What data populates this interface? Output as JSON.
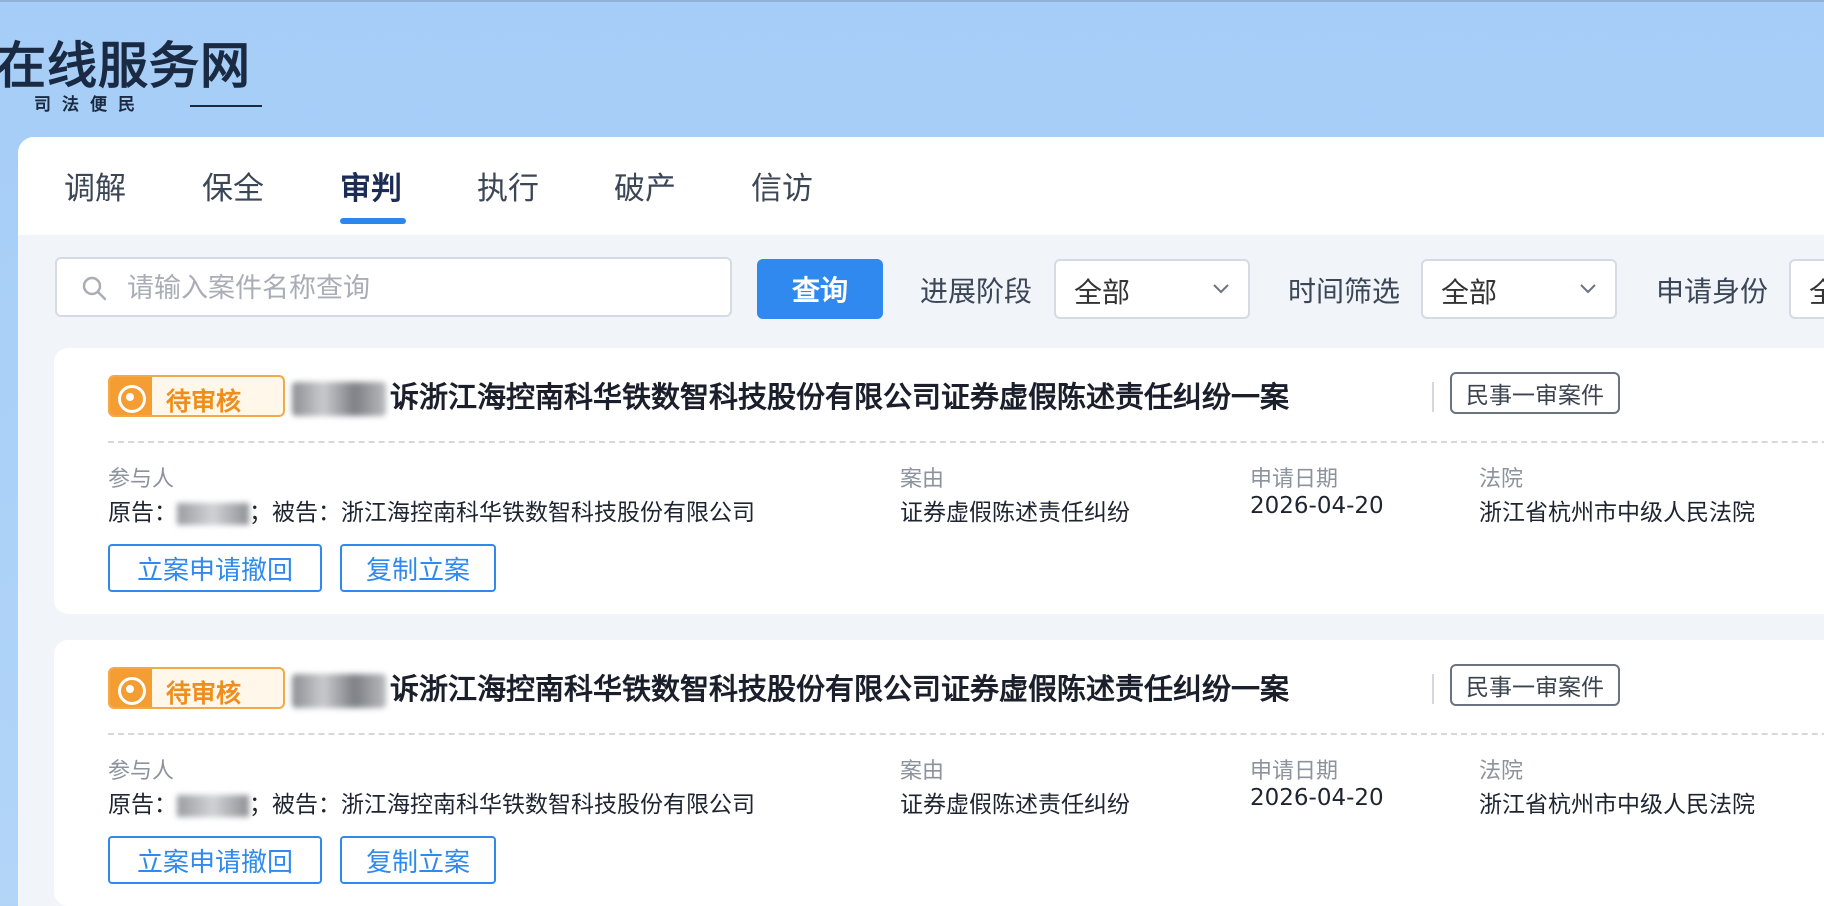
{
  "header": {
    "logo_title": "在线服务网",
    "logo_subtitle": "司法便民"
  },
  "tabs": [
    {
      "label": "调解",
      "active": false
    },
    {
      "label": "保全",
      "active": false
    },
    {
      "label": "审判",
      "active": true
    },
    {
      "label": "执行",
      "active": false
    },
    {
      "label": "破产",
      "active": false
    },
    {
      "label": "信访",
      "active": false
    }
  ],
  "filters": {
    "search_placeholder": "请输入案件名称查询",
    "query_button": "查询",
    "stage_label": "进展阶段",
    "stage_value": "全部",
    "time_label": "时间筛选",
    "time_value": "全部",
    "identity_label": "申请身份",
    "identity_value": "全"
  },
  "cases": [
    {
      "status": "待审核",
      "title": "诉浙江海控南科华铁数智科技股份有限公司证券虚假陈述责任纠纷一案",
      "case_type": "民事一审案件",
      "participants_label": "参与人",
      "plaintiff_label": "原告：",
      "defendant_part": "；被告：浙江海控南科华铁数智科技股份有限公司",
      "cause_label": "案由",
      "cause_value": "证券虚假陈述责任纠纷",
      "date_label": "申请日期",
      "date_value": "2026-04-20",
      "court_label": "法院",
      "court_value": "浙江省杭州市中级人民法院",
      "withdraw_button": "立案申请撤回",
      "copy_button": "复制立案"
    },
    {
      "status": "待审核",
      "title": "诉浙江海控南科华铁数智科技股份有限公司证券虚假陈述责任纠纷一案",
      "case_type": "民事一审案件",
      "participants_label": "参与人",
      "plaintiff_label": "原告：",
      "defendant_part": "；被告：浙江海控南科华铁数智科技股份有限公司",
      "cause_label": "案由",
      "cause_value": "证券虚假陈述责任纠纷",
      "date_label": "申请日期",
      "date_value": "2026-04-20",
      "court_label": "法院",
      "court_value": "浙江省杭州市中级人民法院",
      "withdraw_button": "立案申请撤回",
      "copy_button": "复制立案"
    }
  ],
  "colors": {
    "accent": "#2f89ee",
    "status_orange": "#f39d33",
    "header_bg": "#a5cdf7"
  },
  "icons": [
    "search-icon",
    "chevron-down-icon",
    "pending-clock-icon"
  ]
}
